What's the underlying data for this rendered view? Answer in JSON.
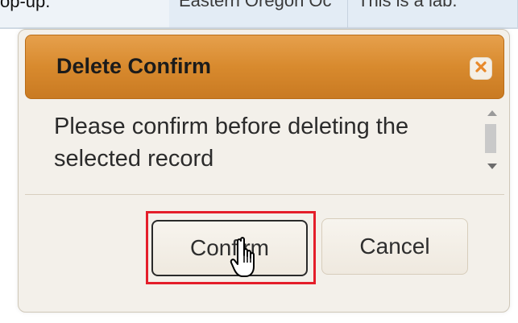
{
  "background": {
    "left_text": "op-up.",
    "cell_1_text": "Eastern Oregon Oc",
    "cell_2_text": "This is a lab."
  },
  "dialog": {
    "title": "Delete Confirm",
    "close_icon": "close-icon",
    "message": "Please confirm before deleting the selected record",
    "confirm_label": "Confirm",
    "cancel_label": "Cancel"
  },
  "colors": {
    "titlebar": "#d88a2e",
    "close_x": "#e8892a",
    "highlight": "#e41e2a",
    "dialog_bg": "#f3f0ea"
  },
  "pointer": "hand-pointer-icon"
}
